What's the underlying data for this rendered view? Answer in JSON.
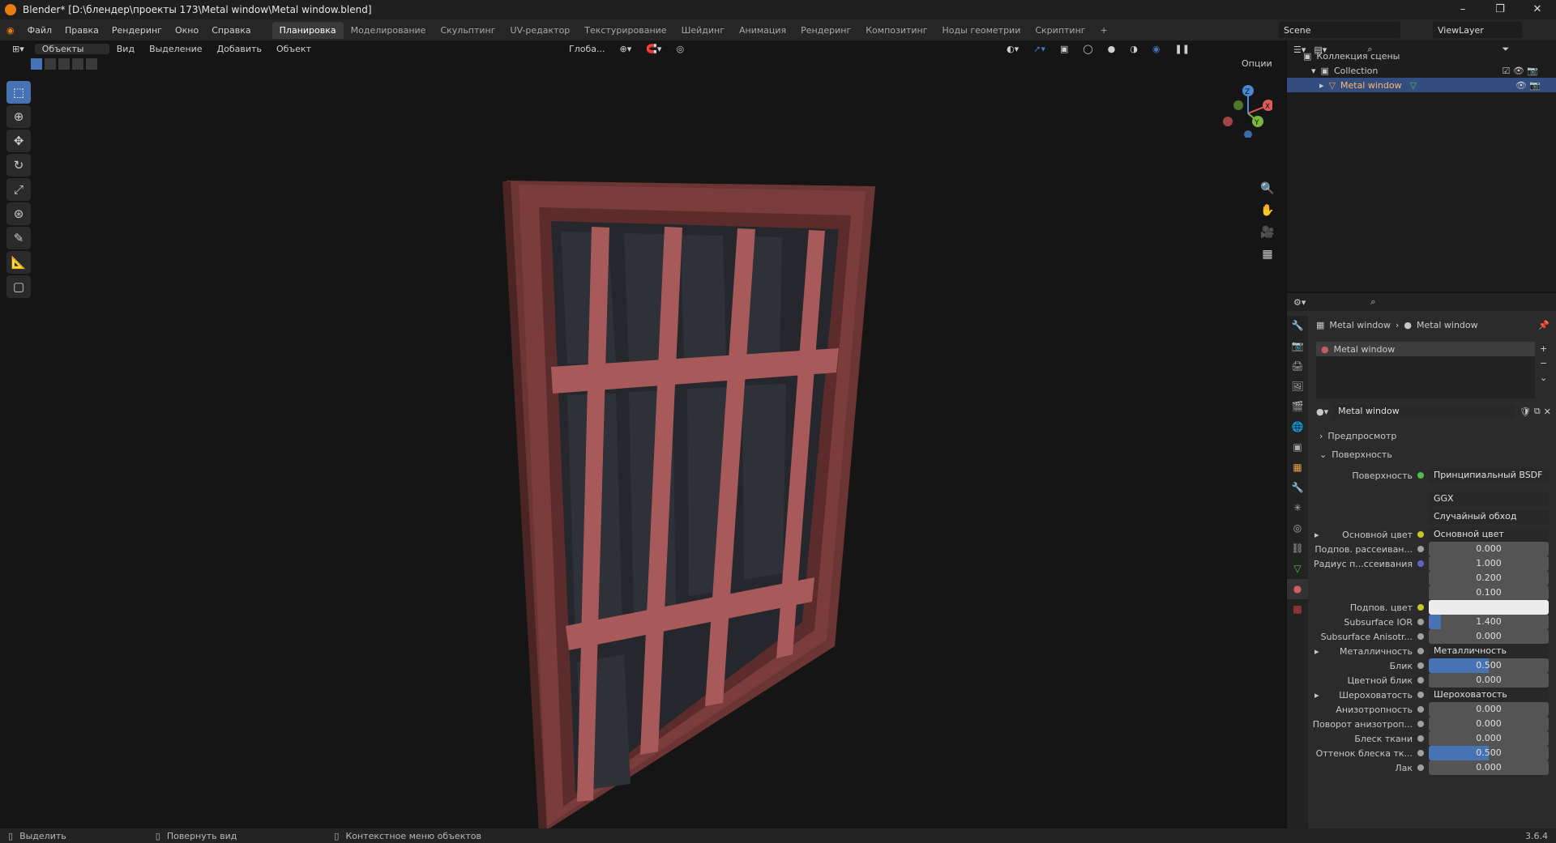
{
  "window": {
    "title": "Blender* [D:\\блендер\\проекты 173\\Metal window\\Metal window.blend]",
    "minimize": "–",
    "restore": "❐",
    "close": "✕"
  },
  "menu": [
    "Файл",
    "Правка",
    "Рендеринг",
    "Окно",
    "Справка"
  ],
  "workspaces": [
    "Планировка",
    "Моделирование",
    "Скульптинг",
    "UV-редактор",
    "Текстурирование",
    "Шейдинг",
    "Анимация",
    "Рендеринг",
    "Композитинг",
    "Ноды геометрии",
    "Скриптинг",
    "+"
  ],
  "scene": {
    "name": "Scene",
    "view_layer": "ViewLayer"
  },
  "viewport": {
    "mode": "Объекты",
    "menus": [
      "Вид",
      "Выделение",
      "Добавить",
      "Объект"
    ],
    "transform": "Глоба...",
    "options": "Опции",
    "gizmo": {
      "x": "X",
      "y": "Y",
      "z": "Z"
    }
  },
  "outliner": {
    "root": "Коллекция сцены",
    "collection": "Collection",
    "object": "Metal window"
  },
  "properties": {
    "breadcrumb": [
      "Metal window",
      "Metal window"
    ],
    "slot": "Metal window",
    "material": "Metal window",
    "panels": {
      "preview": "Предпросмотр",
      "surface": "Поверхность"
    },
    "surface_shader": {
      "label": "Поверхность",
      "value": "Принципиальный BSDF"
    },
    "distribution": "GGX",
    "subsurface_method": "Случайный обход",
    "rows": [
      {
        "label": "Основной цвет",
        "value": "Основной цвет",
        "kind": "link",
        "expand": "▸",
        "dot": "yellow"
      },
      {
        "label": "Подпов. рассеиван...",
        "value": "0.000",
        "kind": "num",
        "dot": "grey"
      },
      {
        "label": "Радиус п...ссеивания",
        "value": "1.000",
        "kind": "num",
        "dot": "blue"
      },
      {
        "label": "",
        "value": "0.200",
        "kind": "num",
        "dot": ""
      },
      {
        "label": "",
        "value": "0.100",
        "kind": "num",
        "dot": ""
      },
      {
        "label": "Подпов. цвет",
        "value": "",
        "kind": "color",
        "dot": "yellow"
      },
      {
        "label": "Subsurface IOR",
        "value": "1.400",
        "kind": "num",
        "dot": "grey",
        "fill": 0.1
      },
      {
        "label": "Subsurface Anisotr...",
        "value": "0.000",
        "kind": "num",
        "dot": "grey"
      },
      {
        "label": "Металличность",
        "value": "Металличность",
        "kind": "link",
        "expand": "▸",
        "dot": "grey"
      },
      {
        "label": "Блик",
        "value": "0.500",
        "kind": "num",
        "dot": "grey",
        "fill": 0.5
      },
      {
        "label": "Цветной блик",
        "value": "0.000",
        "kind": "num",
        "dot": "grey"
      },
      {
        "label": "Шероховатость",
        "value": "Шероховатость",
        "kind": "link",
        "expand": "▸",
        "dot": "grey"
      },
      {
        "label": "Анизотропность",
        "value": "0.000",
        "kind": "num",
        "dot": "grey"
      },
      {
        "label": "Поворот анизотроп...",
        "value": "0.000",
        "kind": "num",
        "dot": "grey"
      },
      {
        "label": "Блеск ткани",
        "value": "0.000",
        "kind": "num",
        "dot": "grey"
      },
      {
        "label": "Оттенок блеска тк...",
        "value": "0.500",
        "kind": "num",
        "dot": "grey",
        "fill": 0.5
      },
      {
        "label": "Лак",
        "value": "0.000",
        "kind": "num",
        "dot": "grey"
      }
    ]
  },
  "status": {
    "select": "Выделить",
    "rotate": "Повернуть вид",
    "context": "Контекстное меню объектов",
    "version": "3.6.4"
  },
  "colors": {
    "accent": "#4772b3",
    "frame": "#7a3d3b",
    "bars": "#a85a5a",
    "glass": "#2a2c33"
  }
}
